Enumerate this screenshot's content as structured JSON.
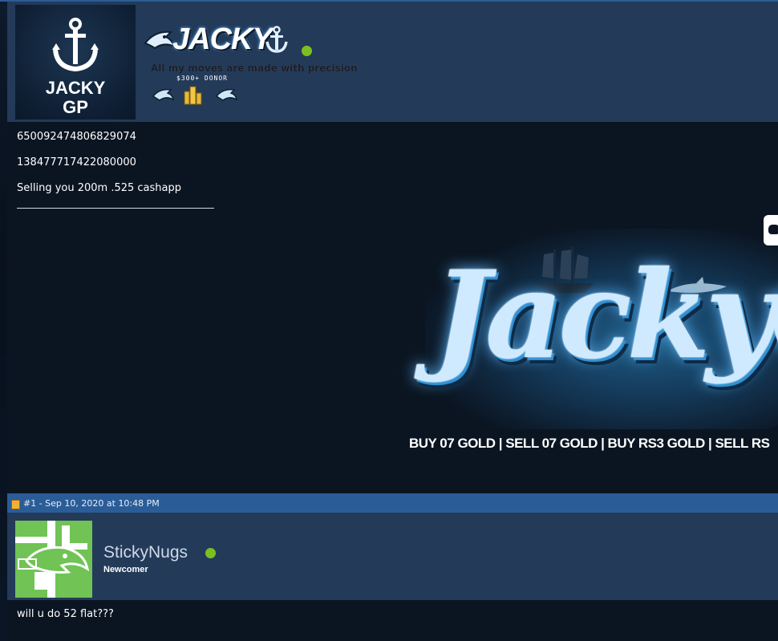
{
  "post1": {
    "avatar": {
      "line1": "JACKY",
      "line2": "GP"
    },
    "username": "JACKY",
    "online": true,
    "user_title": "All my moves are made with precision",
    "donor_label": "$300+ DONOR",
    "badges": [
      "shark-badge",
      "gold-coins-badge",
      "shark-badge"
    ],
    "content": [
      "650092474806829074",
      "138477717422080000",
      "Selling you 200m .525 cashapp"
    ],
    "signature": {
      "banner_word": "JackyG",
      "banner_sub": "BUY 07 GOLD | SELL 07 GOLD | BUY RS3 GOLD | SELL RS"
    }
  },
  "post2": {
    "meta": "#1 - Sep 10, 2020 at 10:48 PM",
    "username": "StickyNugs",
    "online": true,
    "rank": "Newcomer",
    "content": "will u do 52 flat???"
  },
  "colors": {
    "page_bg": "#0b1522",
    "header_bg": "#233a59",
    "bar_bg": "#2a5d98",
    "online": "#7bc023",
    "avatar2_bg": "#70c354"
  }
}
